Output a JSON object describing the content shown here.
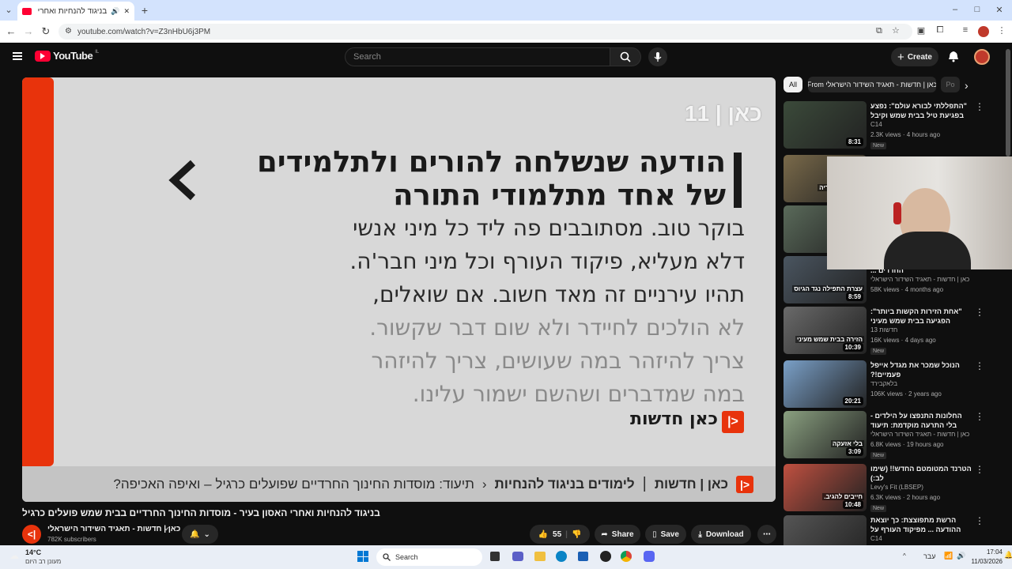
{
  "browser": {
    "tab_title": "בניגוד להנחיות ואחרי האסון",
    "new_tab": "+",
    "url": "youtube.com/watch?v=Z3nHbU6j3PM",
    "window_controls": [
      "–",
      "□",
      "✕"
    ]
  },
  "youtube": {
    "logo": "YouTube",
    "country": "IL",
    "search_placeholder": "Search",
    "create_label": "Create"
  },
  "video": {
    "channel_logo": "כאן | 11",
    "headline_line1": "הודעה שנשלחה להורים ולתלמידים",
    "headline_line2": "של אחד מתלמודי התורה",
    "body_lines": [
      "בוקר טוב. מסתובבים פה ליד כל מיני אנשי",
      "דלא מעליא, פיקוד העורף וכל מיני חבר'ה.",
      "תהיו עירניים זה מאד חשוב. אם שואלים,",
      "לא הולכים לחיידר ולא שום דבר שקשור.",
      "צריך להיזהר במה שעושים, צריך להיזהר",
      "במה שמדברים ושהשם ישמור עלינו."
    ],
    "brand": "כאן חדשות",
    "ticker_brand": "כאן | חדשות",
    "ticker_segment": "לימודים בניגוד להנחיות",
    "ticker_text": "תיעוד: מוסדות החינוך החרדיים שפועלים כרגיל – ואיפה האכיפה?",
    "title": "בניגוד להנחיות ואחרי האסון בעיר - מוסדות החינוך החרדיים בבית שמש פועלים כרגיל",
    "channel": "כאן | חדשות - תאגיד השידור הישראלי",
    "subscribers": "782K subscribers",
    "likes": "55",
    "share": "Share",
    "save": "Save",
    "download": "Download"
  },
  "sidebar": {
    "chips": [
      "All",
      "From כאן | חדשות - תאגיד השידור הישראלי",
      "Po"
    ],
    "recs": [
      {
        "title": "\"התפללתי לבורא עולם\": נפצע בפגיעת טיל בבית שמש וקיבל את ...",
        "channel": "C14",
        "meta": "2.3K views · 4 hours ago",
        "badge": "New",
        "duration": "8:31",
        "thumb": "#3b4a3a"
      },
      {
        "title": "",
        "channel": "",
        "meta": "",
        "badge": "",
        "duration": "",
        "thumb": "#7a6a4a",
        "overlay": "ינית ההיסטוריה"
      },
      {
        "title": "",
        "channel": "",
        "meta": "",
        "badge": "",
        "duration": "",
        "thumb": "#5a6a5a"
      },
      {
        "title": "הקולות מהפגנת הענק של החרדים ...",
        "channel": "כאן | חדשות - תאגיד השידור הישראלי",
        "meta": "58K views · 4 months ago",
        "badge": "",
        "duration": "8:59",
        "thumb": "#4a5560",
        "overlay": "עצרת התפילה נגד הגיוס"
      },
      {
        "title": "\"אחת הזירות הקשות ביותר\": הפגיעה בבית שמש מעיני השוטרים",
        "channel": "13 חדשות",
        "meta": "16K views · 4 days ago",
        "badge": "New",
        "duration": "10:39",
        "thumb": "#6a6a6a",
        "overlay": "הזירה בבית שמש מעיני"
      },
      {
        "title": "הנוכל שמכר את מגדל אייפל פעמיים!?",
        "channel": "בלאקבירד",
        "meta": "106K views · 2 years ago",
        "badge": "",
        "duration": "20:21",
        "thumb": "#7aa0c8"
      },
      {
        "title": "החלונות התנפצו על הילדים - בלי התרעה מוקדמת: תיעוד דרמטי ...",
        "channel": "כאן | חדשות - תאגיד השידור הישראלי",
        "meta": "6.8K views · 19 hours ago",
        "badge": "New",
        "duration": "3:09",
        "thumb": "#8aa080",
        "overlay": "בלי אזעקה"
      },
      {
        "title": "הטרנד המטומטם החדש!! (שימו לב:)",
        "channel": "Levy's Fit (LBSEP)",
        "meta": "6.3K views · 2 hours ago",
        "badge": "New",
        "duration": "10:48",
        "thumb": "#c05040",
        "overlay": "חייבים להגיב."
      },
      {
        "title": "הרשת מתפוצצת: כך יוצאת ההודעה ... מפיקוד העורף על שחרור האזרחים",
        "channel": "C14",
        "meta": "",
        "badge": "",
        "duration": "",
        "thumb": "#555"
      }
    ]
  },
  "taskbar": {
    "weather_temp": "14°C",
    "weather_desc": "מעונן רב היום",
    "search": "Search",
    "lang": "עבר",
    "time": "17:04",
    "date": "11/03/2026"
  },
  "colors": {
    "accent_red": "#ff0033",
    "kan_red": "#e8330c"
  }
}
